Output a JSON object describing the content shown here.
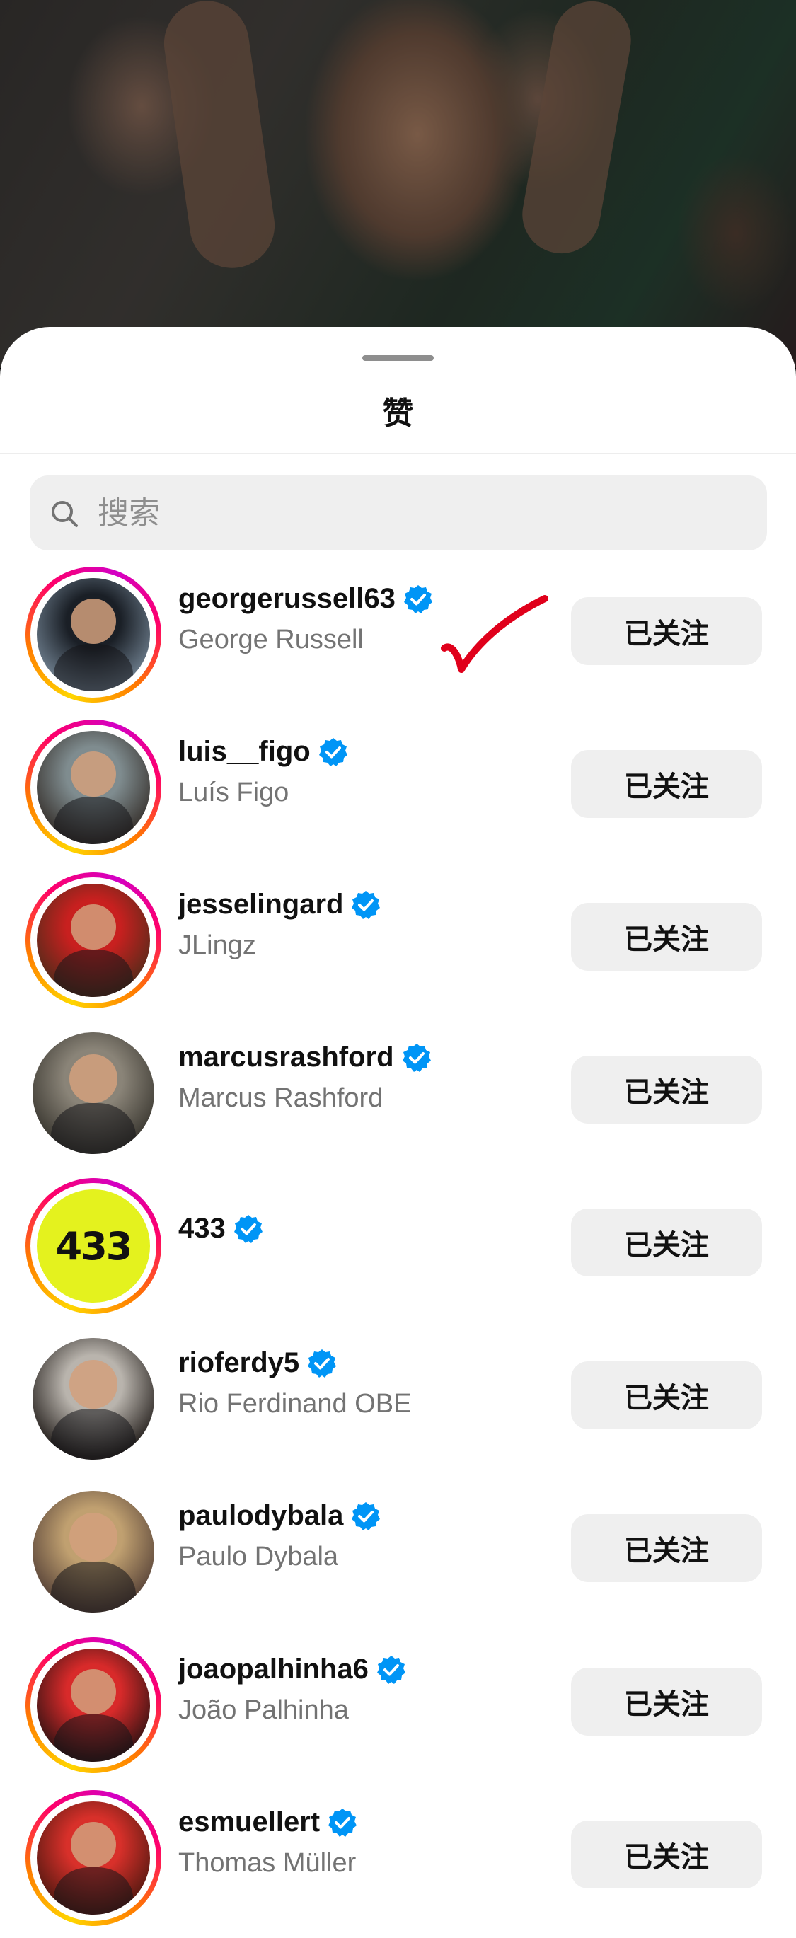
{
  "sheet": {
    "title": "赞"
  },
  "search": {
    "placeholder": "搜索"
  },
  "users": [
    {
      "username": "georgerussell63",
      "full_name": "George Russell",
      "verified": true,
      "story_ring": true,
      "avatar_colors": [
        "#1a1f26",
        "#6b7b8a"
      ],
      "button": "已关注"
    },
    {
      "username": "luis__figo",
      "full_name": "Luís Figo",
      "verified": true,
      "story_ring": true,
      "avatar_colors": [
        "#7f8c8f",
        "#3a3531"
      ],
      "button": "已关注"
    },
    {
      "username": "jesselingard",
      "full_name": "JLingz",
      "verified": true,
      "story_ring": true,
      "avatar_colors": [
        "#c8201f",
        "#5a2a1a"
      ],
      "button": "已关注"
    },
    {
      "username": "marcusrashford",
      "full_name": "Marcus Rashford",
      "verified": true,
      "story_ring": false,
      "avatar_colors": [
        "#8a8478",
        "#3d3a33"
      ],
      "button": "已关注"
    },
    {
      "username": "433",
      "full_name": "",
      "verified": true,
      "story_ring": true,
      "avatar_colors": [
        "#e4f21e",
        "#111111"
      ],
      "avatar_text": "433",
      "button": "已关注"
    },
    {
      "username": "rioferdy5",
      "full_name": "Rio Ferdinand OBE",
      "verified": true,
      "story_ring": false,
      "avatar_colors": [
        "#b9b4ad",
        "#2a2522"
      ],
      "button": "已关注"
    },
    {
      "username": "paulodybala",
      "full_name": "Paulo Dybala",
      "verified": true,
      "story_ring": false,
      "avatar_colors": [
        "#c0a070",
        "#5b463a"
      ],
      "button": "已关注"
    },
    {
      "username": "joaopalhinha6",
      "full_name": "João Palhinha",
      "verified": true,
      "story_ring": true,
      "avatar_colors": [
        "#d82a2a",
        "#3a1414"
      ],
      "button": "已关注"
    },
    {
      "username": "esmuellert",
      "full_name": "Thomas Müller",
      "verified": true,
      "story_ring": true,
      "avatar_colors": [
        "#d8302a",
        "#5a1a12"
      ],
      "button": "已关注"
    }
  ],
  "colors": {
    "verified_badge": "#0095f6",
    "annotation": "#e0001b"
  }
}
